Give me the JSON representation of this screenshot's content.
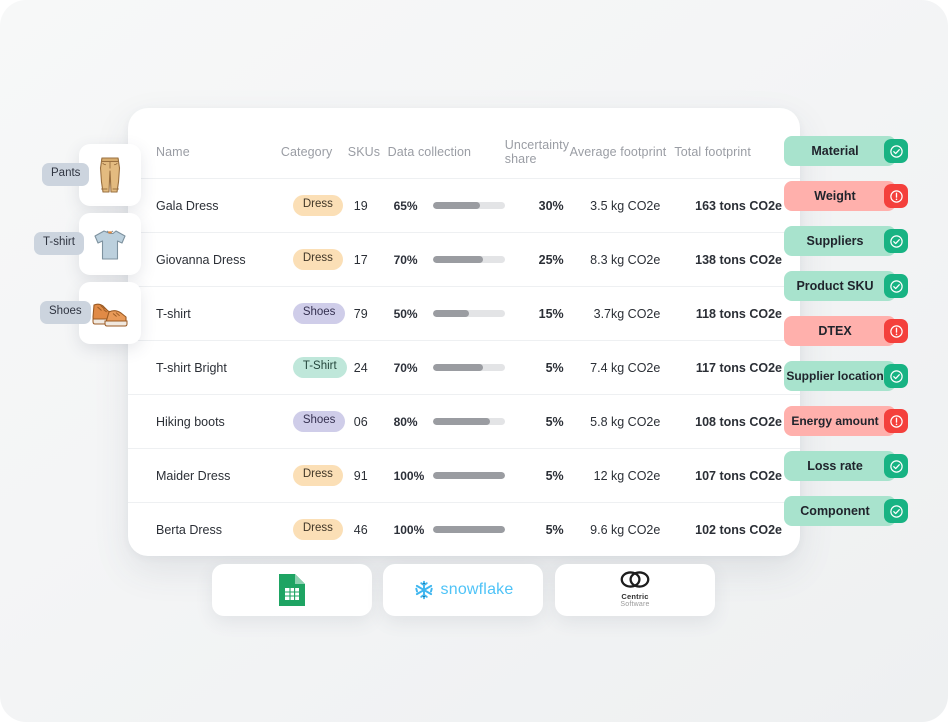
{
  "table": {
    "columns": [
      "Name",
      "Category",
      "SKUs",
      "Data collection",
      "Uncertainty share",
      "Average footprint",
      "Total footprint"
    ],
    "rows": [
      {
        "name": "Gala Dress",
        "category": "Dress",
        "category_style": "dress",
        "skus": "19",
        "data_pct": "65%",
        "data_value": 65,
        "uncertainty": "30%",
        "average": "3.5 kg CO2e",
        "total": "163 tons CO2e"
      },
      {
        "name": "Giovanna Dress",
        "category": "Dress",
        "category_style": "dress",
        "skus": "17",
        "data_pct": "70%",
        "data_value": 70,
        "uncertainty": "25%",
        "average": "8.3 kg CO2e",
        "total": "138 tons CO2e"
      },
      {
        "name": "T-shirt",
        "category": "Shoes",
        "category_style": "shoes",
        "skus": "79",
        "data_pct": "50%",
        "data_value": 50,
        "uncertainty": "15%",
        "average": "3.7kg CO2e",
        "total": "118 tons CO2e"
      },
      {
        "name": "T-shirt Bright",
        "category": "T-Shirt",
        "category_style": "tshirt",
        "skus": "24",
        "data_pct": "70%",
        "data_value": 70,
        "uncertainty": "5%",
        "average": "7.4 kg CO2e",
        "total": "117 tons CO2e"
      },
      {
        "name": "Hiking boots",
        "category": "Shoes",
        "category_style": "shoes",
        "skus": "06",
        "data_pct": "80%",
        "data_value": 80,
        "uncertainty": "5%",
        "average": "5.8 kg CO2e",
        "total": "108 tons CO2e"
      },
      {
        "name": "Maider Dress",
        "category": "Dress",
        "category_style": "dress",
        "skus": "91",
        "data_pct": "100%",
        "data_value": 100,
        "uncertainty": "5%",
        "average": "12 kg CO2e",
        "total": "107 tons CO2e"
      },
      {
        "name": "Berta Dress",
        "category": "Dress",
        "category_style": "dress",
        "skus": "46",
        "data_pct": "100%",
        "data_value": 100,
        "uncertainty": "5%",
        "average": "9.6 kg CO2e",
        "total": "102 tons CO2e"
      }
    ]
  },
  "products": [
    {
      "label": "Pants",
      "icon": "pants-image"
    },
    {
      "label": "T-shirt",
      "icon": "tshirt-image"
    },
    {
      "label": "Shoes",
      "icon": "shoes-image"
    }
  ],
  "attributes": [
    {
      "label": "Material",
      "status": "ok",
      "icon": "check-circle-icon"
    },
    {
      "label": "Weight",
      "status": "warn",
      "icon": "alert-circle-icon"
    },
    {
      "label": "Suppliers",
      "status": "ok",
      "icon": "check-circle-icon"
    },
    {
      "label": "Product SKU",
      "status": "ok",
      "icon": "check-circle-icon"
    },
    {
      "label": "DTEX",
      "status": "warn",
      "icon": "alert-circle-icon"
    },
    {
      "label": "Supplier location",
      "status": "ok",
      "icon": "check-circle-icon"
    },
    {
      "label": "Energy amount",
      "status": "warn",
      "icon": "alert-circle-icon"
    },
    {
      "label": "Loss rate",
      "status": "ok",
      "icon": "check-circle-icon"
    },
    {
      "label": "Component",
      "status": "ok",
      "icon": "check-circle-icon"
    }
  ],
  "integrations": [
    {
      "name": "Google Sheets",
      "icon": "google-sheets-icon",
      "text": ""
    },
    {
      "name": "snowflake",
      "icon": "snowflake-icon",
      "text": "snowflake"
    },
    {
      "name": "Centric Software",
      "icon": "centric-icon",
      "text": "Centric",
      "text2": "Software"
    }
  ],
  "colors": {
    "ok": "#18b383",
    "ok_bg": "#a8e3cd",
    "warn": "#f4403c",
    "warn_bg": "#ffb0ac",
    "pill_dress": "#fbdfb6",
    "pill_shoes": "#cfcde9",
    "pill_tshirt": "#bfe7da",
    "bar_fill": "#9a9ca1"
  }
}
